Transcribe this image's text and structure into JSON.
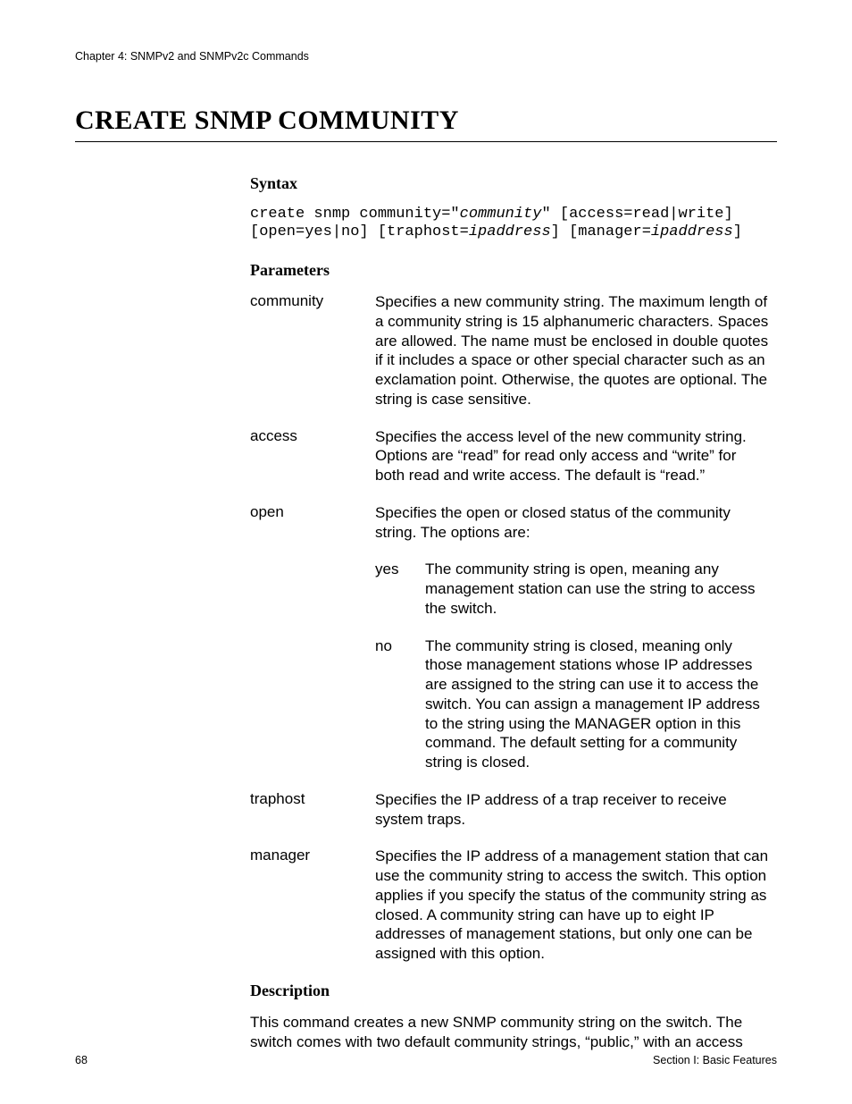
{
  "header": {
    "running_head": "Chapter 4: SNMPv2 and SNMPv2c Commands"
  },
  "title": "CREATE SNMP COMMUNITY",
  "sections": {
    "syntax": {
      "heading": "Syntax",
      "line1_a": "create snmp community=\"",
      "line1_arg": "community",
      "line1_b": "\" [access=read|write]",
      "line2_a": "[open=yes|no] [traphost=",
      "line2_arg1": "ipaddress",
      "line2_b": "] [manager=",
      "line2_arg2": "ipaddress",
      "line2_c": "]"
    },
    "parameters": {
      "heading": "Parameters",
      "items": [
        {
          "name": "community",
          "desc": "Specifies a new community string. The maximum length of a community string is 15 alphanumeric characters. Spaces are allowed. The name must be enclosed in double quotes if it includes a space or other special character such as an exclamation point. Otherwise, the quotes are optional. The string is case sensitive."
        },
        {
          "name": "access",
          "desc": "Specifies the access level of the new community string. Options are “read” for read only access and “write” for both read and write access. The default is “read.”"
        },
        {
          "name": "open",
          "desc": "Specifies the open or closed status of the community string. The options are:",
          "options": [
            {
              "name": "yes",
              "desc": "The community string is open, meaning any management station can use the string to access the switch."
            },
            {
              "name": "no",
              "desc": "The community string is closed, meaning only those management stations whose IP addresses are assigned to the string can use it to access the switch. You can assign a management IP address to the string using the MANAGER option in this command. The default setting for a community string is closed."
            }
          ]
        },
        {
          "name": "traphost",
          "desc": "Specifies the IP address of a trap receiver to receive system traps."
        },
        {
          "name": "manager",
          "desc": "Specifies the IP address of a management station that can use the community string to access the switch. This option applies if you specify the status of the community string as closed. A community string can have up to eight IP addresses of management stations, but only one can be assigned with this option."
        }
      ]
    },
    "description": {
      "heading": "Description",
      "body": "This command creates a new SNMP community string on the switch. The switch comes with two default community strings, “public,” with an access"
    }
  },
  "footer": {
    "page_number": "68",
    "section_label": "Section I: Basic Features"
  }
}
